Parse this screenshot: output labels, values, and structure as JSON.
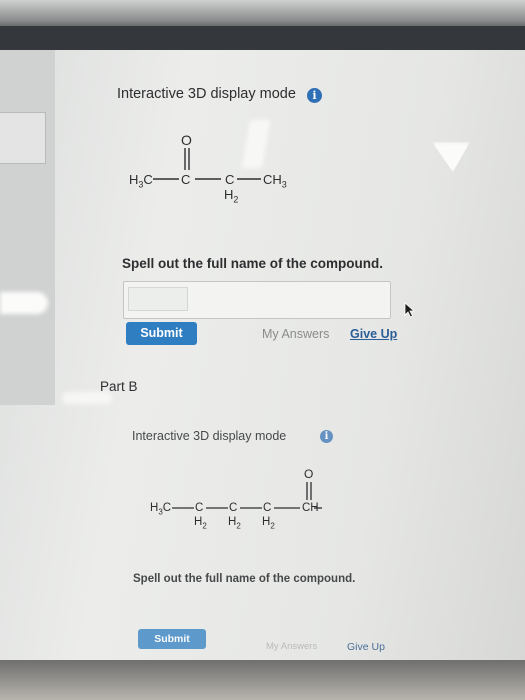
{
  "part_a": {
    "display_mode_label": "Interactive 3D display mode",
    "info_icon": "i",
    "structure": {
      "oxygen": "O",
      "left_group": "H",
      "left_group_sub": "3",
      "left_group_end": "C",
      "c2": "C",
      "c3": "C",
      "c3_sub_h": "H",
      "c3_sub_n": "2",
      "right_group": "CH",
      "right_group_sub": "3"
    },
    "prompt": "Spell out the full name of the compound.",
    "answer_value": "",
    "submit_label": "Submit",
    "my_answers_label": "My Answers",
    "give_up_label": "Give Up"
  },
  "part_b": {
    "title": "Part B",
    "display_mode_label": "Interactive 3D display mode",
    "info_icon": "i",
    "structure": {
      "oxygen": "O",
      "left_group": "H",
      "left_group_sub": "3",
      "left_group_end": "C",
      "c": "C",
      "h": "H",
      "sub_2": "2",
      "right_group": "CH"
    },
    "prompt": "Spell out the full name of the compound.",
    "submit_label": "Submit",
    "my_answers_label": "My Answers",
    "give_up_label": "Give Up"
  },
  "colors": {
    "accent": "#2f7ec1",
    "info": "#2f6fb5",
    "text": "#2e2e30"
  }
}
